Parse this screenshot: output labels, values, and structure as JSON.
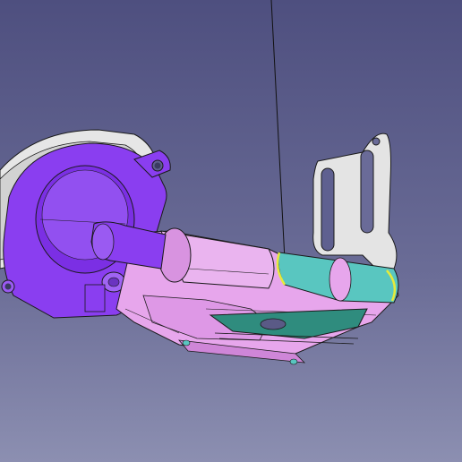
{
  "viewport": {
    "background_top": "#4e4f7f",
    "background_bottom": "#8c8fb1",
    "scene": "3d-cad-model"
  },
  "colors": {
    "purple_body": "#8a3ef0",
    "pink_body": "#e7a6ec",
    "cyan_part": "#59c6c0",
    "teal_plate": "#2f8c7e",
    "gray_part": "#e4e4e4",
    "edge": "#1a1a1a",
    "yellow_highlight": "#e6ea3a"
  }
}
